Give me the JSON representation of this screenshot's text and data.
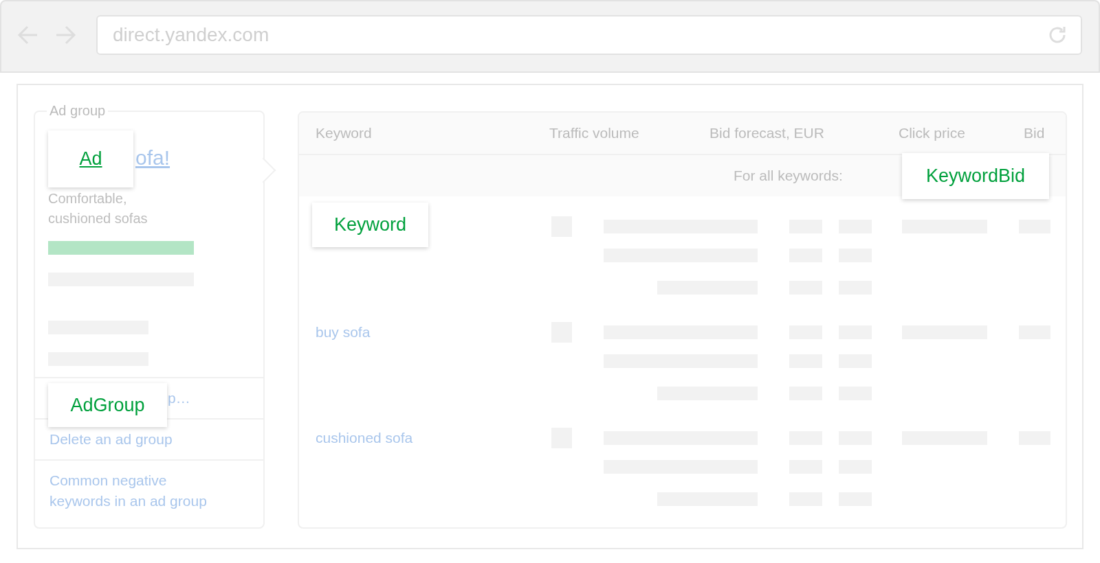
{
  "browser": {
    "url": "direct.yandex.com"
  },
  "ad_group": {
    "legend": "Ad group",
    "headline_visible": "ofa!",
    "description": "Comfortable,\ncushioned sofas",
    "links": [
      {
        "kind": "covered",
        "text": "p…"
      },
      {
        "kind": "link",
        "text": "Delete an ad group"
      },
      {
        "kind": "link",
        "text": "Common negative keywords in an ad group"
      }
    ]
  },
  "table": {
    "columns": [
      "Keyword",
      "Traffic volume",
      "Bid forecast, EUR",
      "Click price",
      "Bid"
    ],
    "all_keywords_label": "For all keywords:",
    "rows": [
      {
        "kind": "covered"
      },
      {
        "kind": "keyword",
        "keyword": "buy sofa"
      },
      {
        "kind": "keyword",
        "keyword": "cushioned sofa"
      }
    ]
  },
  "callouts": [
    {
      "label": "Ad",
      "underlined": true
    },
    {
      "label": "Keyword",
      "underlined": false
    },
    {
      "label": "KeywordBid",
      "underlined": false
    },
    {
      "label": "AdGroup",
      "underlined": false
    }
  ]
}
